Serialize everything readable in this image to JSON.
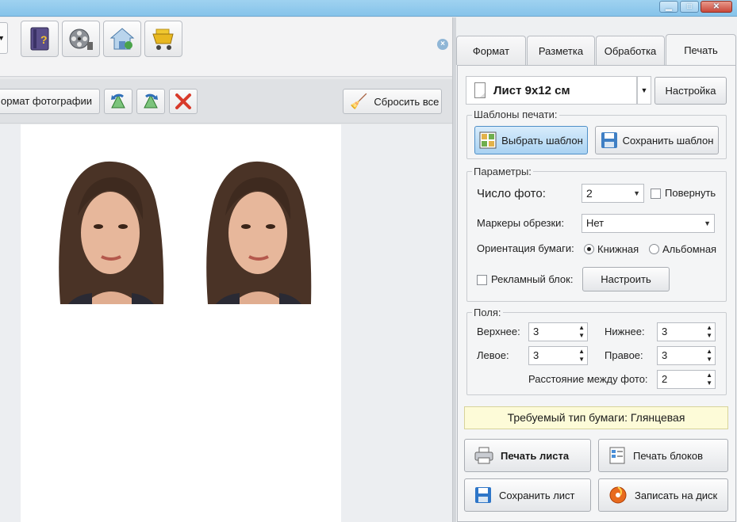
{
  "window": {
    "minimize": "▁",
    "maximize": "□",
    "close": "✕"
  },
  "toolbar": {
    "dropdown_arrow": "▼",
    "icons": [
      "help-book-icon",
      "film-reel-icon",
      "home-icon",
      "shopping-cart-icon"
    ],
    "format_button": "ормат фотографии",
    "reset_button": "Сбросить все"
  },
  "tabs": [
    {
      "label": "Формат",
      "active": false
    },
    {
      "label": "Разметка",
      "active": false
    },
    {
      "label": "Обработка",
      "active": false
    },
    {
      "label": "Печать",
      "active": true
    }
  ],
  "print": {
    "sheet_size": "Лист 9x12 см",
    "settings_button": "Настройка",
    "templates_group": "Шаблоны печати:",
    "choose_template": "Выбрать шаблон",
    "save_template": "Сохранить шаблон",
    "params_group": "Параметры:",
    "photo_count_label": "Число фото:",
    "photo_count_value": "2",
    "rotate_label": "Повернуть",
    "crop_markers_label": "Маркеры обрезки:",
    "crop_markers_value": "Нет",
    "orientation_label": "Ориентация бумаги:",
    "portrait_label": "Книжная",
    "landscape_label": "Альбомная",
    "orientation_selected": "portrait",
    "ad_block_label": "Рекламный блок:",
    "configure_button": "Настроить",
    "fields_group": "Поля:",
    "top_label": "Верхнее:",
    "top_value": "3",
    "bottom_label": "Нижнее:",
    "bottom_value": "3",
    "left_label": "Левое:",
    "left_value": "3",
    "right_label": "Правое:",
    "right_value": "3",
    "spacing_label": "Расстояние между фото:",
    "spacing_value": "2",
    "paper_type": "Требуемый тип бумаги: Глянцевая",
    "print_sheet": "Печать листа",
    "print_blocks": "Печать блоков",
    "save_sheet": "Сохранить лист",
    "burn_disc": "Записать на диск"
  }
}
